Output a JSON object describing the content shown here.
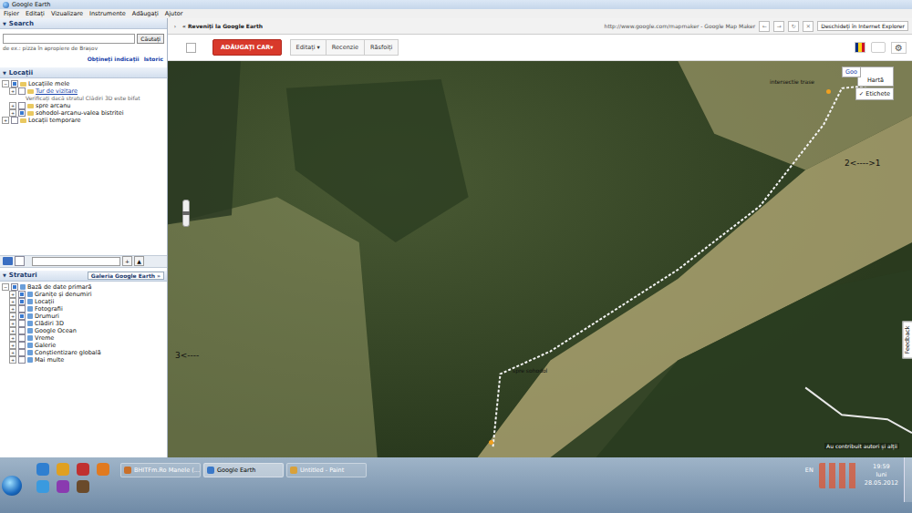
{
  "window": {
    "title": "Google Earth"
  },
  "menu": [
    "Fișier",
    "Editați",
    "Vizualizare",
    "Instrumente",
    "Adăugați",
    "Ajutor"
  ],
  "search": {
    "title": "Search",
    "placeholder": "",
    "button": "Căutați",
    "hint": "de ex.: pizza în apropiere de Brașov",
    "links": [
      "Obțineți indicații",
      "Istoric"
    ]
  },
  "places": {
    "title": "Locații",
    "items": [
      {
        "label": "Locațiile mele",
        "level": 0,
        "kind": "node",
        "checked": true,
        "expanded": true,
        "link": false
      },
      {
        "label": "Tur de vizitare",
        "level": 1,
        "kind": "node",
        "checked": false,
        "expanded": false,
        "link": true
      },
      {
        "label": "Verificați dacă stratul Clădiri 3D este bifat",
        "level": 2,
        "kind": "note",
        "checked": false,
        "expanded": false,
        "link": false
      },
      {
        "label": "spre arcanu",
        "level": 1,
        "kind": "node",
        "checked": false,
        "expanded": false,
        "link": false
      },
      {
        "label": "sohodol-arcanu-valea bistritei",
        "level": 1,
        "kind": "node",
        "checked": true,
        "expanded": false,
        "link": false
      },
      {
        "label": "Locații temporare",
        "level": 0,
        "kind": "node",
        "checked": false,
        "expanded": false,
        "link": false
      }
    ]
  },
  "panel_toolbar": {
    "buttons": [
      "+",
      "▲"
    ]
  },
  "layers": {
    "title": "Straturi",
    "gallery": "Galeria Google Earth »",
    "items": [
      {
        "label": "Bază de date primară",
        "level": 0,
        "checked": true,
        "expanded": true
      },
      {
        "label": "Granițe și denumiri",
        "level": 1,
        "checked": true,
        "expanded": false
      },
      {
        "label": "Locații",
        "level": 1,
        "checked": true,
        "expanded": false
      },
      {
        "label": "Fotografii",
        "level": 1,
        "checked": false,
        "expanded": false
      },
      {
        "label": "Drumuri",
        "level": 1,
        "checked": true,
        "expanded": false
      },
      {
        "label": "Clădiri 3D",
        "level": 1,
        "checked": false,
        "expanded": false
      },
      {
        "label": "Google Ocean",
        "level": 1,
        "checked": false,
        "expanded": false
      },
      {
        "label": "Vreme",
        "level": 1,
        "checked": false,
        "expanded": false
      },
      {
        "label": "Galerie",
        "level": 1,
        "checked": false,
        "expanded": false
      },
      {
        "label": "Conștientizare globală",
        "level": 1,
        "checked": false,
        "expanded": false
      },
      {
        "label": "Mai multe",
        "level": 1,
        "checked": false,
        "expanded": false
      }
    ]
  },
  "browser_bar": {
    "back": "« Reveniți la Google Earth",
    "url": "http://www.google.com/mapmaker - Google Map Maker",
    "open": "Deschideți în Internet Explorer"
  },
  "mapmaker_toolbar": {
    "add": "ADĂUGAȚI CAR▾",
    "buttons": [
      "Editați ▾",
      "Recenzie",
      "Răsfoiți"
    ]
  },
  "map": {
    "labels": [
      "intersectie trase",
      "2<---->1",
      "3<----",
      "spre sohodol"
    ],
    "type": "Hartă",
    "thumb": "Goo",
    "labels_toggle": {
      "label": "Etichete",
      "checked": true
    },
    "credit": "Au contribuit autori și alții",
    "feedback": "Feedback"
  },
  "taskbar": {
    "tasks": [
      {
        "label": "BHITFm.Ro Manele (...",
        "selected": false,
        "color": "#c9702a"
      },
      {
        "label": "Google Earth",
        "selected": true,
        "color": "#3a78c8"
      },
      {
        "label": "Untitled - Paint",
        "selected": false,
        "color": "#d9a13a"
      }
    ],
    "pinned": [
      {
        "color": "#2f7fd0"
      },
      {
        "color": "#e0a020"
      },
      {
        "color": "#c03030"
      },
      {
        "color": "#e07a20"
      },
      {
        "color": "#3a9adf"
      },
      {
        "color": "#8a3ab0"
      },
      {
        "color": "#6a4a2a"
      }
    ],
    "language": "EN",
    "time": "19:59",
    "day": "luni",
    "date": "28.05.2012"
  }
}
